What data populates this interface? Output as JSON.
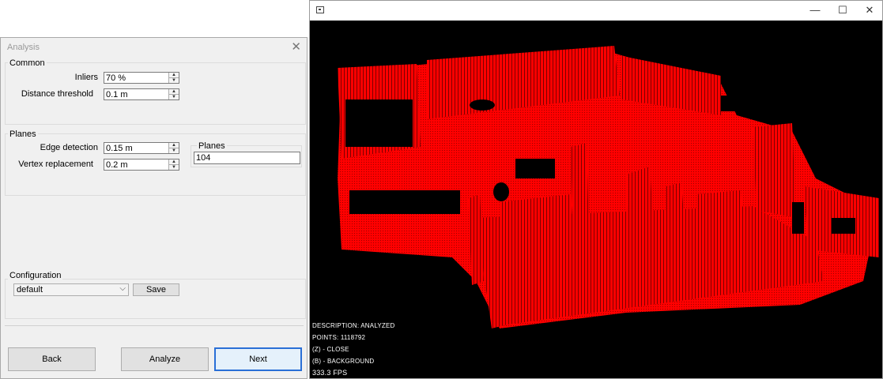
{
  "dialog": {
    "title": "Analysis",
    "close_glyph": "✕",
    "common": {
      "label": "Common",
      "inliers_label": "Inliers",
      "inliers_value": "70 %",
      "distance_label": "Distance threshold",
      "distance_value": "0.1 m"
    },
    "planes_group": {
      "label": "Planes",
      "edge_label": "Edge detection",
      "edge_value": "0.15 m",
      "vertex_label": "Vertex replacement",
      "vertex_value": "0.2 m",
      "count_label": "Planes",
      "count_value": "104"
    },
    "configuration": {
      "label": "Configuration",
      "selected": "default",
      "save_label": "Save"
    },
    "buttons": {
      "back": "Back",
      "analyze": "Analyze",
      "next": "Next"
    }
  },
  "viewer": {
    "minimize_glyph": "—",
    "maximize_glyph": "☐",
    "close_glyph": "✕",
    "point_color": "#ff0000",
    "hud": {
      "description": "DESCRIPTION: ANALYZED",
      "points": "POINTS: 1118792",
      "close_key": "(Z) - CLOSE",
      "background_key": "(B) - BACKGROUND",
      "fps": "333.3 FPS"
    }
  }
}
